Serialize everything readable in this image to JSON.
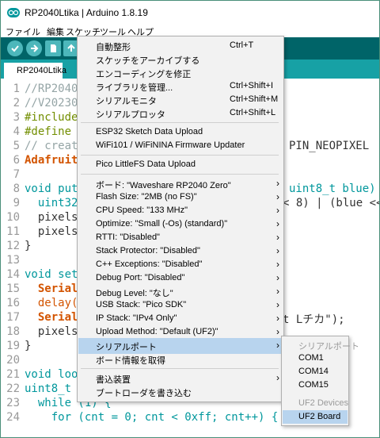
{
  "window": {
    "title": "RP2040Ltika | Arduino 1.8.19"
  },
  "menubar": [
    "ファイル",
    "編集",
    "スケッチ",
    "ツール",
    "ヘルプ"
  ],
  "tab": {
    "label": "RP2040Ltika"
  },
  "editor": {
    "line_numbers": [
      "1",
      "2",
      "3",
      "4",
      "5",
      "6",
      "7",
      "8",
      "9",
      "10",
      "11",
      "12",
      "13",
      "14",
      "15",
      "16",
      "17",
      "18",
      "19",
      "20",
      "21",
      "22",
      "23",
      "24"
    ],
    "lines": [
      "//RP2040",
      "//V20230",
      "#include",
      "#define",
      "// creat",
      "Adafruit",
      "",
      "void put",
      "  uint32",
      "  pixels",
      "  pixels",
      "}",
      "",
      "void set",
      "  Serial",
      "  delay(",
      "  Serial",
      "  pixels",
      "}",
      "",
      "void loo",
      "uint8_t cnt = 0;",
      "  while (1) {",
      "    for (cnt = 0; cnt < 0xff; cnt++) {"
    ],
    "right_fragments": {
      "line5": "PIN_NEOPIXEL",
      "line8": "uint8_t blue)",
      "line9": "< 8) | (blue <<",
      "line17": "t Lチカ\");"
    }
  },
  "tools_menu": {
    "items": [
      {
        "label": "自動整形",
        "shortcut": "Ctrl+T"
      },
      {
        "label": "スケッチをアーカイブする",
        "shortcut": ""
      },
      {
        "label": "エンコーディングを修正",
        "shortcut": ""
      },
      {
        "label": "ライブラリを管理...",
        "shortcut": "Ctrl+Shift+I"
      },
      {
        "label": "シリアルモニタ",
        "shortcut": "Ctrl+Shift+M"
      },
      {
        "label": "シリアルプロッタ",
        "shortcut": "Ctrl+Shift+L"
      },
      {
        "label": "ESP32 Sketch Data Upload",
        "shortcut": ""
      },
      {
        "label": "WiFi101 / WiFiNINA Firmware Updater",
        "shortcut": ""
      },
      {
        "label": "Pico LittleFS Data Upload",
        "shortcut": ""
      },
      {
        "label": "ボード: \"Waveshare RP2040 Zero\"",
        "shortcut": ""
      },
      {
        "label": "Flash Size: \"2MB (no FS)\"",
        "shortcut": ""
      },
      {
        "label": "CPU Speed: \"133 MHz\"",
        "shortcut": ""
      },
      {
        "label": "Optimize: \"Small (-Os) (standard)\"",
        "shortcut": ""
      },
      {
        "label": "RTTI: \"Disabled\"",
        "shortcut": ""
      },
      {
        "label": "Stack Protector: \"Disabled\"",
        "shortcut": ""
      },
      {
        "label": "C++ Exceptions: \"Disabled\"",
        "shortcut": ""
      },
      {
        "label": "Debug Port: \"Disabled\"",
        "shortcut": ""
      },
      {
        "label": "Debug Level: \"なし\"",
        "shortcut": ""
      },
      {
        "label": "USB Stack: \"Pico SDK\"",
        "shortcut": ""
      },
      {
        "label": "IP Stack: \"IPv4 Only\"",
        "shortcut": ""
      },
      {
        "label": "Upload Method: \"Default (UF2)\"",
        "shortcut": ""
      },
      {
        "label": "シリアルポート",
        "shortcut": ""
      },
      {
        "label": "ボード情報を取得",
        "shortcut": ""
      },
      {
        "label": "書込装置",
        "shortcut": ""
      },
      {
        "label": "ブートローダを書き込む",
        "shortcut": ""
      }
    ],
    "arrow": "›"
  },
  "port_submenu": {
    "items": [
      {
        "label": "シリアルポート",
        "disabled": true
      },
      {
        "label": "COM1",
        "disabled": false
      },
      {
        "label": "COM14",
        "disabled": false
      },
      {
        "label": "COM15",
        "disabled": false
      },
      {
        "label": "UF2 Devices",
        "disabled": true
      },
      {
        "label": "UF2 Board",
        "disabled": false,
        "selected": true
      }
    ]
  },
  "colors": {
    "toolbar": "#006468",
    "tabbar": "#17a1a5",
    "highlight": "#b8d4ee",
    "keyword": "#00979c",
    "type": "#d35400"
  }
}
